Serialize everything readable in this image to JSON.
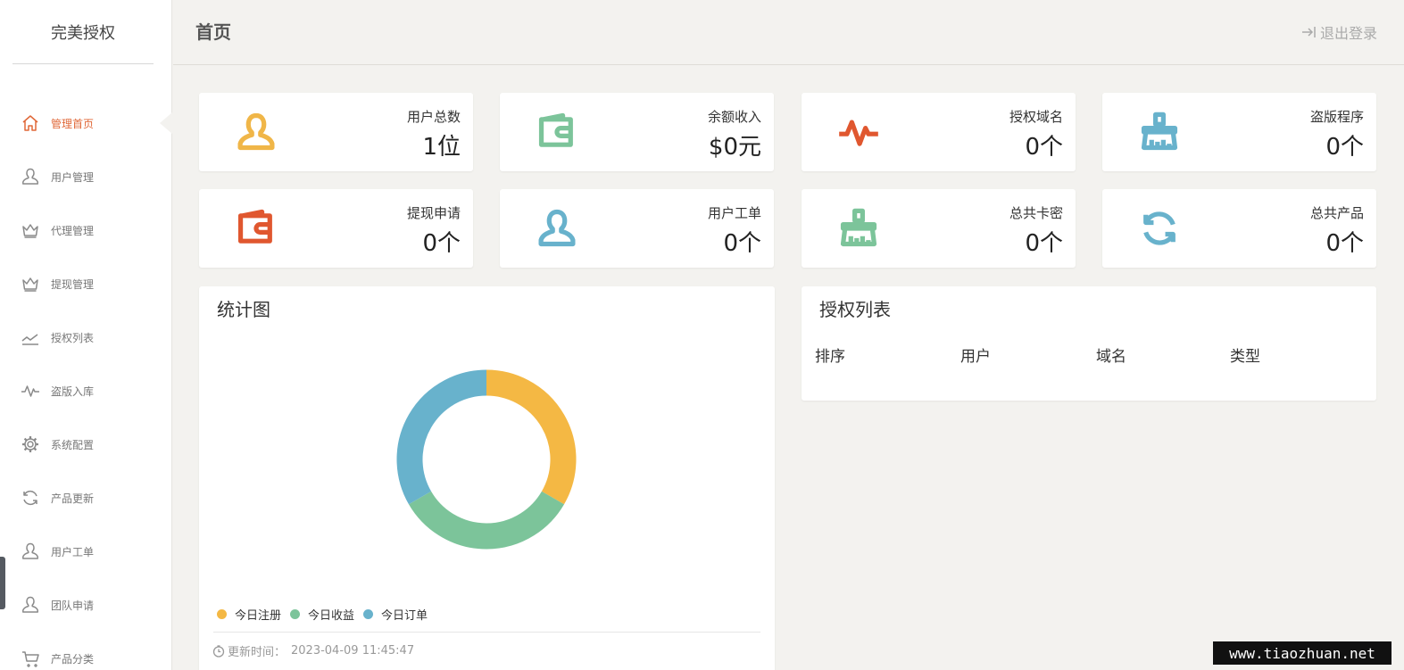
{
  "brand": "完美授权",
  "sidebar": {
    "items": [
      {
        "label": "管理首页",
        "icon": "home-icon",
        "active": true
      },
      {
        "label": "用户管理",
        "icon": "user-icon"
      },
      {
        "label": "代理管理",
        "icon": "crown-icon"
      },
      {
        "label": "提现管理",
        "icon": "crown-icon"
      },
      {
        "label": "授权列表",
        "icon": "trend-icon"
      },
      {
        "label": "盗版入库",
        "icon": "pulse-icon"
      },
      {
        "label": "系统配置",
        "icon": "gear-icon"
      },
      {
        "label": "产品更新",
        "icon": "refresh-icon"
      },
      {
        "label": "用户工单",
        "icon": "user-icon"
      },
      {
        "label": "团队申请",
        "icon": "user-icon"
      },
      {
        "label": "产品分类",
        "icon": "cart-icon"
      }
    ]
  },
  "header": {
    "title": "首页",
    "logout": "退出登录"
  },
  "stats": [
    {
      "label": "用户总数",
      "value": "1位",
      "icon": "user-icon",
      "color": "#f0b648"
    },
    {
      "label": "余额收入",
      "value": "$0元",
      "icon": "wallet-icon",
      "color": "#7cc49a"
    },
    {
      "label": "授权域名",
      "value": "0个",
      "icon": "pulse-icon",
      "color": "#e0572f"
    },
    {
      "label": "盗版程序",
      "value": "0个",
      "icon": "broom-icon",
      "color": "#68b2cc"
    },
    {
      "label": "提现申请",
      "value": "0个",
      "icon": "wallet-icon",
      "color": "#e0572f"
    },
    {
      "label": "用户工单",
      "value": "0个",
      "icon": "user-icon",
      "color": "#68b2cc"
    },
    {
      "label": "总共卡密",
      "value": "0个",
      "icon": "broom-icon",
      "color": "#7cc49a"
    },
    {
      "label": "总共产品",
      "value": "0个",
      "icon": "refresh-icon",
      "color": "#68b2cc"
    }
  ],
  "chart_panel": {
    "title": "统计图",
    "updated_label": "更新时间：",
    "updated_value": "2023-04-09 11:45:47"
  },
  "chart_data": {
    "type": "pie",
    "donut": true,
    "title": "统计图",
    "legend_position": "bottom-left",
    "series": [
      {
        "name": "今日注册",
        "value": 1,
        "color": "#f4b844"
      },
      {
        "name": "今日收益",
        "value": 1,
        "color": "#7cc49a"
      },
      {
        "name": "今日订单",
        "value": 1,
        "color": "#68b2cc"
      }
    ]
  },
  "auth_panel": {
    "title": "授权列表",
    "columns": [
      "排序",
      "用户",
      "域名",
      "类型"
    ]
  },
  "watermark": "www.tiaozhuan.net"
}
